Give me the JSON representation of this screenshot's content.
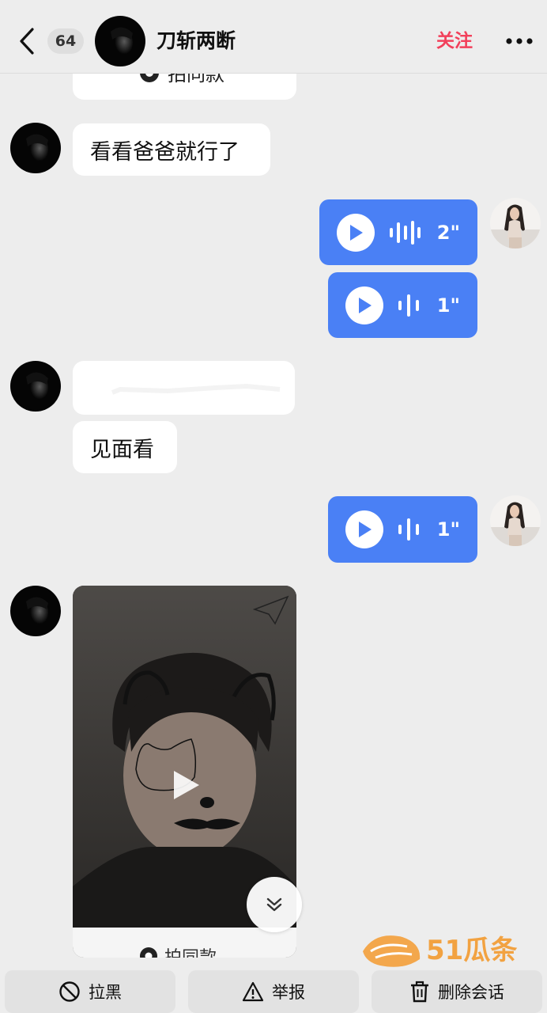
{
  "header": {
    "unread_count": "64",
    "contact_name": "刀斩两断",
    "follow_label": "关注",
    "back_icon": "chevron-left-icon",
    "more_icon": "more-horizontal-icon"
  },
  "colors": {
    "accent_red": "#f2405b",
    "voice_blue": "#4a80f5",
    "bubble_white": "#ffffff",
    "background": "#ededed"
  },
  "messages": {
    "top_card_label": "拍同款",
    "text_1": "看看爸爸就行了",
    "voice_1_duration": "2\"",
    "voice_2_duration": "1\"",
    "text_2": "见面看",
    "voice_3_duration": "1\"",
    "video_card_label": "拍同款"
  },
  "bottom_bar": {
    "block_label": "拉黑",
    "report_label": "举报",
    "delete_label": "删除会话"
  },
  "watermark": {
    "brand": "51瓜条"
  }
}
